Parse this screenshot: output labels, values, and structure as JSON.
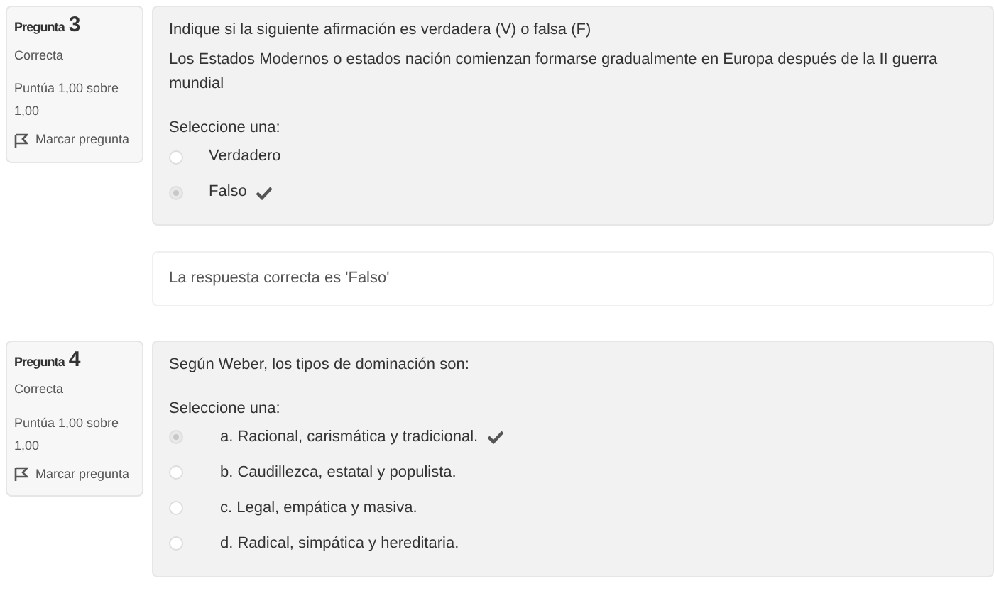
{
  "questions": [
    {
      "heading": "Pregunta",
      "number": "3",
      "state": "Correcta",
      "grade": "Puntúa 1,00 sobre 1,00",
      "flag": "Marcar pregunta",
      "prompt": [
        "Indique si la siguiente afirmación es verdadera (V) o falsa (F)",
        "Los Estados Modernos o estados nación comienzan formarse gradualmente en Europa después de la II guerra mundial"
      ],
      "select_label": "Seleccione una:",
      "options": [
        {
          "label": "Verdadero",
          "selected": false,
          "correct": false
        },
        {
          "label": "Falso",
          "selected": true,
          "correct": true
        }
      ],
      "feedback": "La respuesta correcta es 'Falso'"
    },
    {
      "heading": "Pregunta",
      "number": "4",
      "state": "Correcta",
      "grade": "Puntúa 1,00 sobre 1,00",
      "flag": "Marcar pregunta",
      "prompt": [
        "Según Weber, los tipos de dominación son:"
      ],
      "select_label": "Seleccione una:",
      "options": [
        {
          "label": "a. Racional, carismática y tradicional.",
          "selected": true,
          "correct": true
        },
        {
          "label": "b. Caudillezca, estatal y populista.",
          "selected": false,
          "correct": false
        },
        {
          "label": "c. Legal, empática y masiva.",
          "selected": false,
          "correct": false
        },
        {
          "label": "d. Radical, simpática y hereditaria.",
          "selected": false,
          "correct": false
        }
      ]
    }
  ]
}
